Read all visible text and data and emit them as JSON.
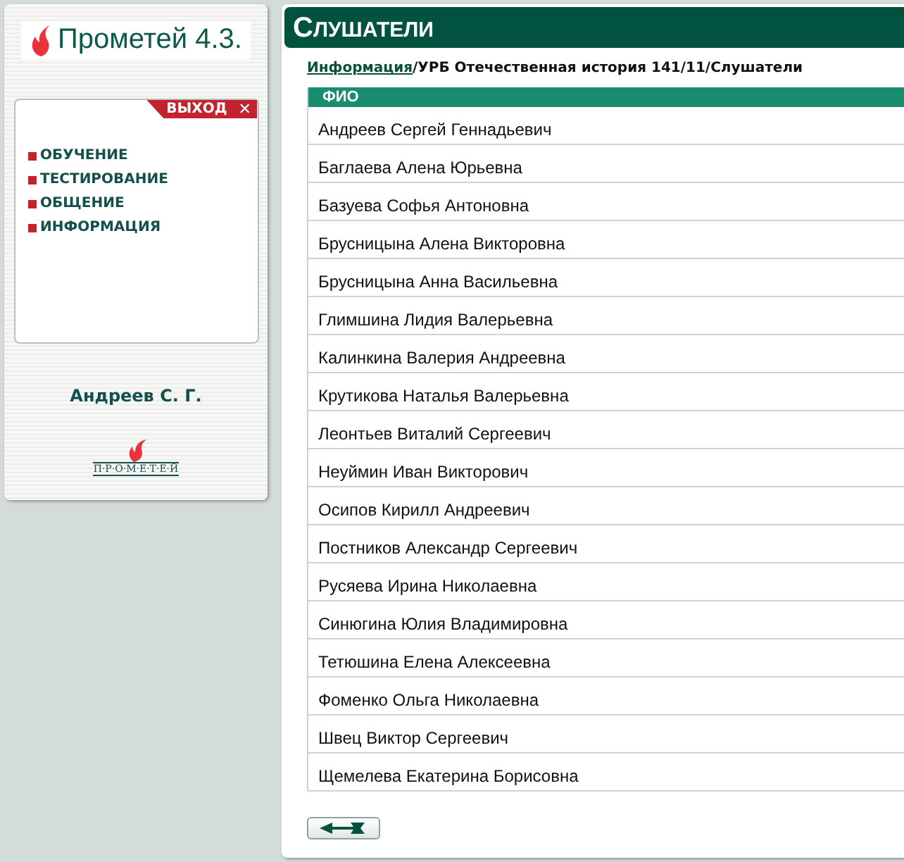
{
  "sidebar": {
    "logo_text": "Прометей 4.3.",
    "exit_label": "ВЫХОД",
    "exit_icon": "✕",
    "menu": [
      {
        "label": "ОБУЧЕНИЕ"
      },
      {
        "label": "ТЕСТИРОВАНИЕ"
      },
      {
        "label": "ОБЩЕНИЕ"
      },
      {
        "label": "ИНФОРМАЦИЯ"
      }
    ],
    "user_name": "Андреев С. Г.",
    "footer_logo_text": "П·Р·О·М·Е·Т·Е·Й"
  },
  "page": {
    "title": "СЛУШАТЕЛИ",
    "breadcrumb": {
      "link": "Информация",
      "rest": "/УРБ Отечественная история 141/11/Слушатели"
    },
    "table": {
      "columns": [
        "ФИО"
      ],
      "rows": [
        "Андреев Сергей Геннадьевич",
        "Баглаева Алена Юрьевна",
        "Базуева Софья Антоновна",
        "Брусницына Алена Викторовна",
        "Брусницына Анна Васильевна",
        "Глимшина Лидия Валерьевна",
        "Калинкина Валерия Андреевна",
        "Крутикова Наталья Валерьевна",
        "Леонтьев Виталий Сергеевич",
        "Неуймин Иван Викторович",
        "Осипов Кирилл Андреевич",
        "Постников Александр Сергеевич",
        "Русяева Ирина Николаевна",
        "Синюгина Юлия Владимировна",
        "Тетюшина Елена Алексеевна",
        "Фоменко Ольга Николаевна",
        "Швец Виктор Сергеевич",
        "Щемелева Екатерина Борисовна"
      ]
    }
  }
}
